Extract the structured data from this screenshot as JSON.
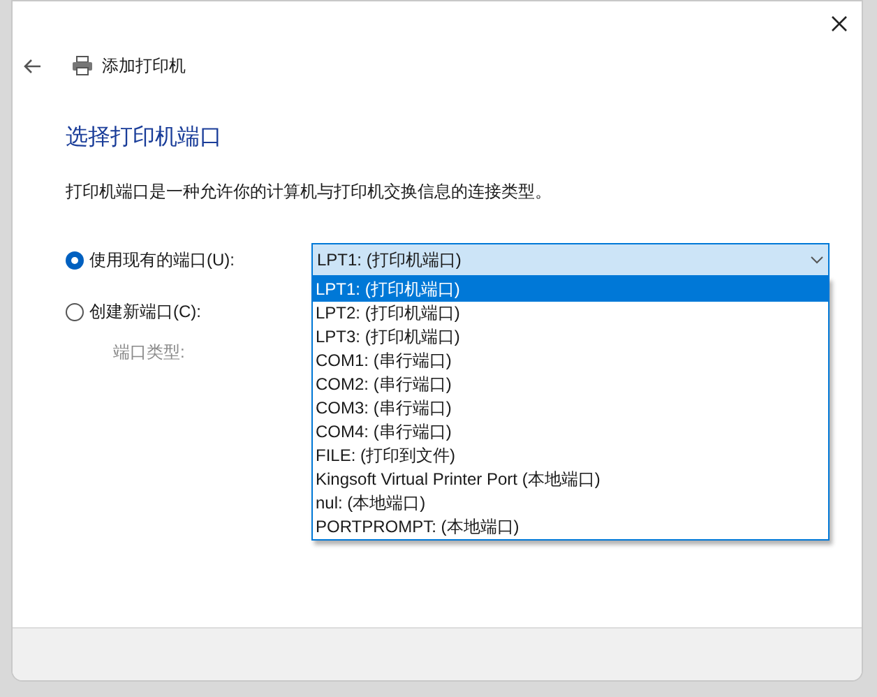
{
  "window": {
    "title": "添加打印机"
  },
  "heading": "选择打印机端口",
  "description": "打印机端口是一种允许你的计算机与打印机交换信息的连接类型。",
  "port_options": [
    {
      "label": "使用现有的端口(U):",
      "selected": true
    },
    {
      "label": "创建新端口(C):",
      "selected": false
    }
  ],
  "existing_port": {
    "value": "LPT1: (打印机端口)",
    "expanded": true,
    "items": [
      {
        "label": "LPT1: (打印机端口)",
        "selected": true
      },
      {
        "label": "LPT2: (打印机端口)",
        "selected": false
      },
      {
        "label": "LPT3: (打印机端口)",
        "selected": false
      },
      {
        "label": "COM1: (串行端口)",
        "selected": false
      },
      {
        "label": "COM2: (串行端口)",
        "selected": false
      },
      {
        "label": "COM3: (串行端口)",
        "selected": false
      },
      {
        "label": "COM4: (串行端口)",
        "selected": false
      },
      {
        "label": "FILE: (打印到文件)",
        "selected": false
      },
      {
        "label": "Kingsoft Virtual Printer Port (本地端口)",
        "selected": false
      },
      {
        "label": "nul: (本地端口)",
        "selected": false
      },
      {
        "label": "PORTPROMPT: (本地端口)",
        "selected": false
      }
    ]
  },
  "new_port": {
    "label": "端口类型:",
    "disabled": true
  }
}
